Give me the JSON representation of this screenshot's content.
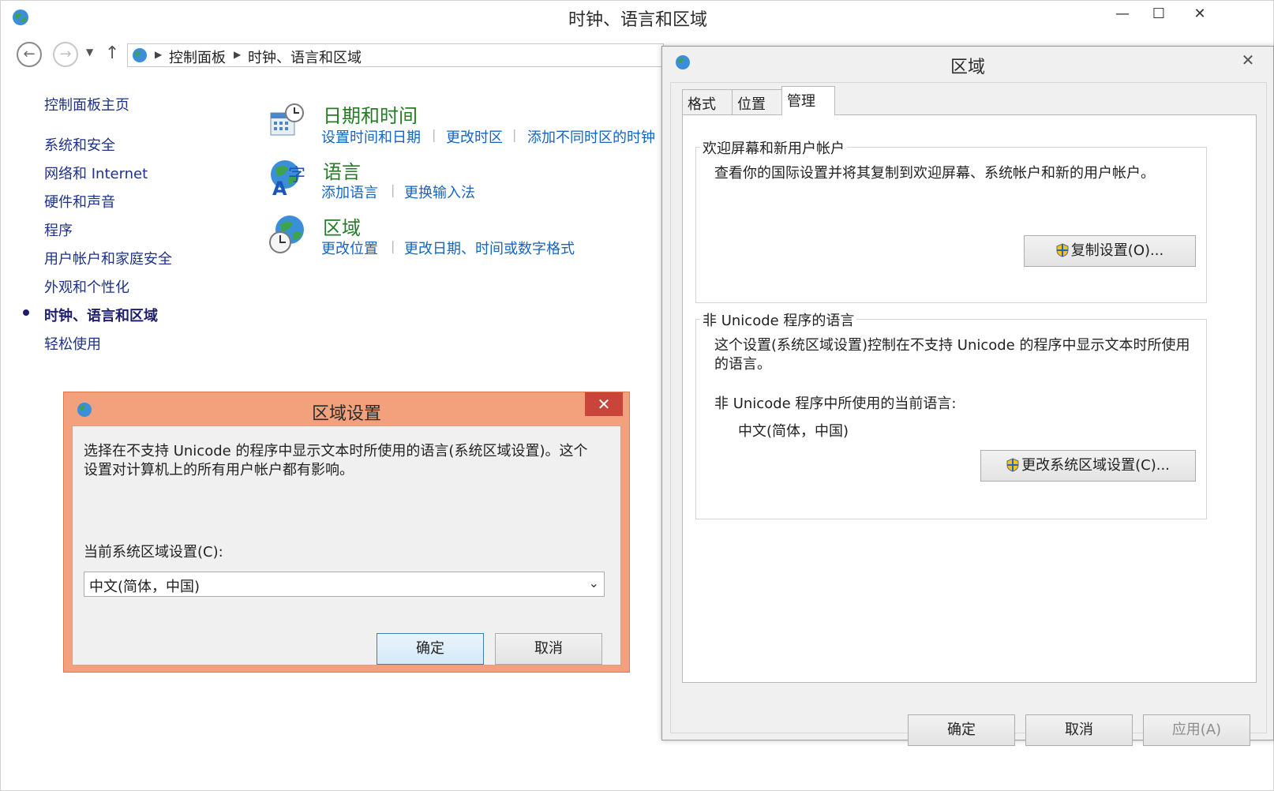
{
  "main_window": {
    "title": "时钟、语言和区域",
    "minimize_glyph": "—",
    "maximize_glyph": "☐",
    "close_glyph": "✕",
    "breadcrumb": [
      "控制面板",
      "时钟、语言和区域"
    ]
  },
  "sidebar": {
    "home": "控制面板主页",
    "items": [
      {
        "label": "系统和安全"
      },
      {
        "label": "网络和 Internet"
      },
      {
        "label": "硬件和声音"
      },
      {
        "label": "程序"
      },
      {
        "label": "用户帐户和家庭安全"
      },
      {
        "label": "外观和个性化"
      },
      {
        "label": "时钟、语言和区域",
        "current": true
      },
      {
        "label": "轻松使用"
      }
    ]
  },
  "categories": [
    {
      "title": "日期和时间",
      "icon": "clock-calendar-icon",
      "links": [
        "设置时间和日期",
        "更改时区",
        "添加不同时区的时钟"
      ]
    },
    {
      "title": "语言",
      "icon": "language-globe-icon",
      "links": [
        "添加语言",
        "更换输入法"
      ]
    },
    {
      "title": "区域",
      "icon": "region-globe-clock-icon",
      "links": [
        "更改位置",
        "更改日期、时间或数字格式"
      ]
    }
  ],
  "region_dialog": {
    "title": "区域",
    "close_glyph": "✕",
    "tabs": [
      "格式",
      "位置",
      "管理"
    ],
    "active_tab": "管理",
    "welcome_group": {
      "label": "欢迎屏幕和新用户帐户",
      "text": "查看你的国际设置并将其复制到欢迎屏幕、系统帐户和新的用户帐户。",
      "button": "复制设置(O)..."
    },
    "unicode_group": {
      "label": "非 Unicode 程序的语言",
      "text": "这个设置(系统区域设置)控制在不支持 Unicode 的程序中显示文本时所使用的语言。",
      "current_label": "非 Unicode 程序中所使用的当前语言:",
      "current_value": "中文(简体，中国)",
      "button": "更改系统区域设置(C)..."
    },
    "ok": "确定",
    "cancel": "取消",
    "apply": "应用(A)"
  },
  "region_settings_dialog": {
    "title": "区域设置",
    "close_glyph": "✕",
    "description": "选择在不支持 Unicode 的程序中显示文本时所使用的语言(系统区域设置)。这个设置对计算机上的所有用户帐户都有影响。",
    "select_label": "当前系统区域设置(C):",
    "select_value": "中文(简体，中国)",
    "ok": "确定",
    "cancel": "取消"
  },
  "colors": {
    "link_blue": "#1565c0",
    "category_green": "#267c26",
    "dialog_orange": "#f3a07c",
    "close_red": "#c9453b"
  }
}
